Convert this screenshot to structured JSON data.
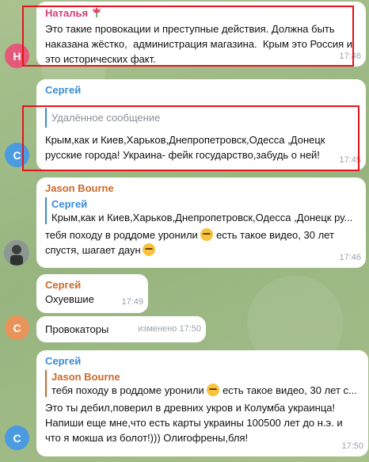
{
  "colors": {
    "natalya_name": "#d63d75",
    "sergey_name": "#3a8dd5",
    "jason_name": "#cc6a2c",
    "avatar_natalya": "#e6587a",
    "avatar_sergey": "#4a9be0",
    "highlight": "#e8121b"
  },
  "messages": [
    {
      "sender": "Наталья",
      "sender_icon": "tulip-icon",
      "text": "Это такие провокации и преступные действия. Должна быть наказана жёстко,  администрация магазина.  Крым это Россия и это исторических факт.",
      "time": "17:46",
      "avatar_letter": "Н"
    },
    {
      "sender": "Сергей",
      "quote_text": "Удалённое сообщение",
      "text": "Крым,как и Киев,Харьков,Днепропетровск,Одесса ,Донецк русские города! Украина- фейк государство,забудь о ней!",
      "time": "17:45",
      "avatar_letter": "С"
    },
    {
      "sender": "Jason Bourne",
      "quote_name": "Сергей",
      "quote_text": "Крым,как и Киев,Харьков,Днепропетровск,Одесса ,Донецк ру...",
      "text_part1": "тебя походу в роддоме уронили",
      "text_part2": "есть такое видео, 30 лет спустя, шагает даун",
      "time": "17:46"
    },
    {
      "sender": "Сергей",
      "text": "Охуевшие",
      "time": "17:49"
    },
    {
      "text": "Провокаторы",
      "time": "изменено 17:50"
    },
    {
      "sender": "Сергей",
      "quote_name": "Jason Bourne",
      "quote_text": "тебя походу в роддоме уронили",
      "quote_text2": "есть такое видео, 30 лет с...",
      "text": "Это ты дебил,поверил в древних укров и Колумба украинца! Напиши еще мне,что есть карты украины 100500 лет до н.э. и что я мокша из болот!))) Олигофрены,бля!",
      "time": "17:50",
      "avatar_letter": "С"
    }
  ]
}
